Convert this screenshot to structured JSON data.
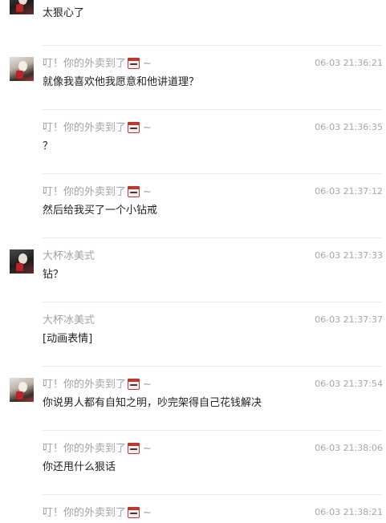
{
  "messages": [
    {
      "sender": "",
      "badge": false,
      "time": "",
      "text": "太狠心了",
      "avatar": "dark"
    },
    {
      "sender": "叮！你的外卖到了",
      "badge": true,
      "time": "06-03 21:36:21",
      "text": "就像我喜欢他我愿意和他讲道理？",
      "avatar": "light"
    },
    {
      "sender": "叮！你的外卖到了",
      "badge": true,
      "time": "06-03 21:36:35",
      "text": "？",
      "avatar": ""
    },
    {
      "sender": "叮！你的外卖到了",
      "badge": true,
      "time": "06-03 21:37:12",
      "text": "然后给我买了一个小钻戒",
      "avatar": ""
    },
    {
      "sender": "大杯冰美式",
      "badge": false,
      "time": "06-03 21:37:33",
      "text": "钻？",
      "avatar": "dark"
    },
    {
      "sender": "大杯冰美式",
      "badge": false,
      "time": "06-03 21:37:37",
      "text": "[动画表情]",
      "avatar": ""
    },
    {
      "sender": "叮！你的外卖到了",
      "badge": true,
      "time": "06-03 21:37:54",
      "text": "你说男人都有自知之明，吵完架得自己花钱解决",
      "avatar": "light"
    },
    {
      "sender": "叮！你的外卖到了",
      "badge": true,
      "time": "06-03 21:38:06",
      "text": "你还甩什么狠话",
      "avatar": ""
    },
    {
      "sender": "叮！你的外卖到了",
      "badge": true,
      "time": "06-03 21:38:21",
      "text": "",
      "avatar": ""
    }
  ],
  "badge_suffix": "~",
  "icons": {
    "badge": "lunchbox-icon",
    "avatar": "avatar-image"
  },
  "colors": {
    "sender": "#a3a3a3",
    "time": "#a6a6a6",
    "text": "#222222",
    "divider": "#ededed",
    "badge": "#c0392b"
  }
}
